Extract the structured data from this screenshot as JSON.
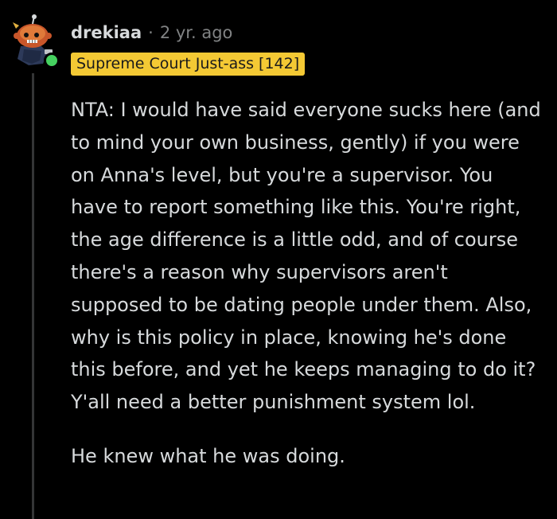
{
  "comment": {
    "username": "drekiaa",
    "separator": "·",
    "timestamp": "2 yr. ago",
    "flair": "Supreme Court Just-ass [142]",
    "paragraphs": [
      "NTA: I would have said everyone sucks here (and to mind your own business, gently) if you were on Anna's level, but you're a supervisor. You have to report something like this. You're right, the age difference is a little odd, and of course there's a reason why supervisors aren't supposed to be dating people under them. Also, why is this policy in place, knowing he's done this before, and yet he keeps managing to do it? Y'all need a better punishment system lol.",
      "He knew what he was doing."
    ]
  },
  "colors": {
    "background": "#000000",
    "text": "#d7dadc",
    "meta": "#818384",
    "flair_bg": "#f4c934",
    "online": "#46d160",
    "thread_line": "#343536"
  },
  "icons": {
    "avatar": "snoo-avatar-icon",
    "online": "online-status-icon"
  }
}
